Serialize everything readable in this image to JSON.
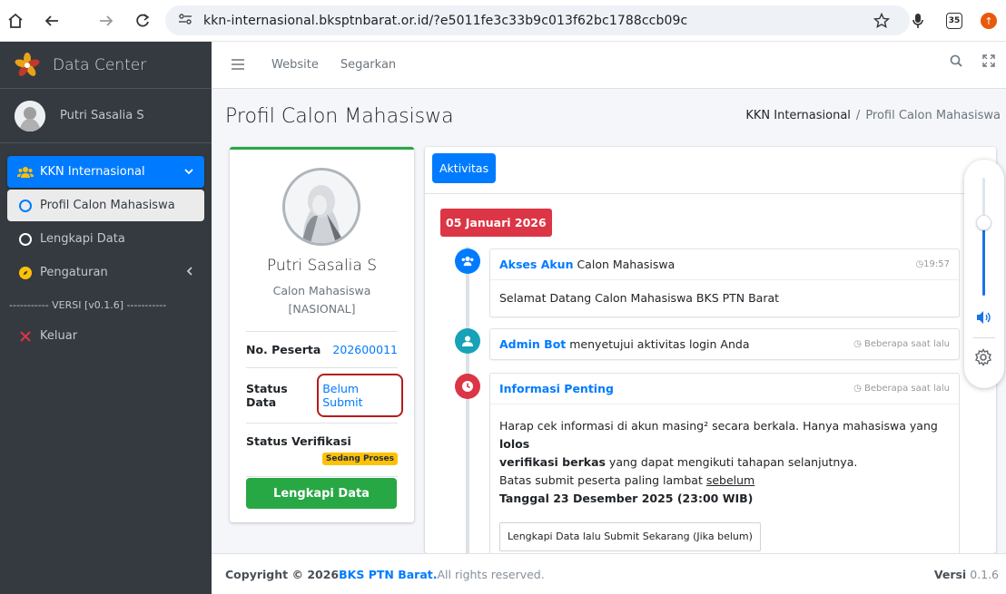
{
  "browser": {
    "url": "kkn-internasional.bksptnbarat.or.id/?e5011fe3c33b9c013f62bc1788ccb09c",
    "ext_badge": "35"
  },
  "sidebar": {
    "brand": "Data Center",
    "user_name": "Putri Sasalia S",
    "items": [
      {
        "label": "KKN Internasional"
      },
      {
        "label": "Profil Calon Mahasiswa"
      },
      {
        "label": "Lengkapi Data"
      },
      {
        "label": "Pengaturan"
      }
    ],
    "version_line": "----------- VERSI [v0.1.6] -----------",
    "logout": "Keluar"
  },
  "topnav": {
    "links": [
      "Website",
      "Segarkan"
    ]
  },
  "page": {
    "title": "Profil Calon Mahasiswa",
    "breadcrumb": [
      "KKN Internasional",
      "/",
      "Profil Calon Mahasiswa"
    ]
  },
  "profile": {
    "name": "Putri Sasalia S",
    "role": "Calon Mahasiswa",
    "category": "[NASIONAL]",
    "rows": [
      {
        "label": "No. Peserta",
        "value": "202600011"
      },
      {
        "label": "Status Data",
        "value": "Belum Submit"
      },
      {
        "label": "Status Verifikasi",
        "value": "Sedang Proses"
      }
    ],
    "button": "Lengkapi Data"
  },
  "activity": {
    "tab": "Aktivitas",
    "date_label": "05 Januari 2026",
    "items": [
      {
        "title_link": "Akses Akun",
        "title_rest": " Calon Mahasiswa",
        "time": "19:57",
        "body": "Selamat Datang Calon Mahasiswa BKS PTN Barat"
      },
      {
        "title_link": "Admin Bot",
        "title_rest": " menyetujui aktivitas login Anda",
        "time": "Beberapa saat lalu"
      },
      {
        "title_link": "Informasi Penting",
        "time": "Beberapa saat lalu",
        "body_1a": "Harap cek informasi di akun masing² secara berkala. Hanya mahasiswa yang ",
        "body_1b": "lolos",
        "body_2a": "verifikasi berkas",
        "body_2b": " yang dapat mengikuti tahapan selanjutnya.",
        "body_3a": "Batas submit peserta paling lambat ",
        "body_3b": "sebelum",
        "body_4": "Tanggal 23 Desember 2025 (23:00 WIB)",
        "button": "Lengkapi Data lalu Submit Sekarang (Jika belum)"
      }
    ]
  },
  "volume": {
    "level": 0.62
  },
  "footer": {
    "copyright": "Copyright © 2026 ",
    "org": "BKS PTN Barat.",
    "rights": " All rights reserved.",
    "version_label": "Versi",
    "version": " 0.1.6"
  },
  "colors": {
    "sidebar_bg": "#343a40",
    "primary": "#007bff",
    "success": "#28a745",
    "danger": "#dc3545",
    "warning": "#ffc107"
  }
}
